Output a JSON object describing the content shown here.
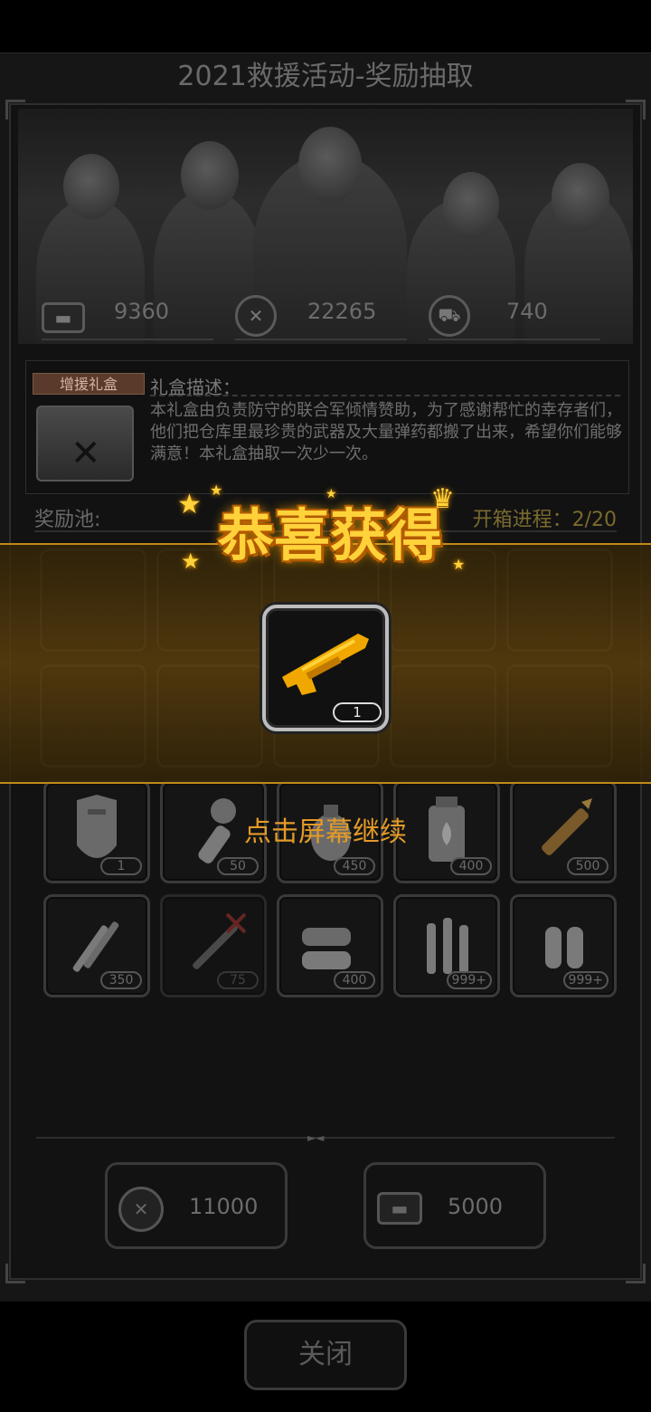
{
  "title": "2021救援活动-奖励抽取",
  "currencies": [
    {
      "icon": "card-icon",
      "value": "9360"
    },
    {
      "icon": "crossed-swords-coin-icon",
      "value": "22265"
    },
    {
      "icon": "car-coin-icon",
      "value": "740"
    }
  ],
  "gift": {
    "tag": "增援礼盒",
    "desc_title": "礼盒描述：",
    "desc_body": "本礼盒由负责防守的联合军倾情赞助，为了感谢帮忙的幸存者们，他们把仓库里最珍贵的武器及大量弹药都搬了出来，希望你们能够满意！本礼盒抽取一次少一次。"
  },
  "pool": {
    "label": "奖励池:",
    "progress": "开箱进程：2/20"
  },
  "items_row3": [
    {
      "icon": "riot-shield-icon",
      "qty": "1"
    },
    {
      "icon": "stick-grenade-icon",
      "qty": "50"
    },
    {
      "icon": "grenade-icon",
      "qty": "450"
    },
    {
      "icon": "incendiary-grenade-icon",
      "qty": "400"
    },
    {
      "icon": "rocket-ammo-icon",
      "qty": "500"
    }
  ],
  "items_row4": [
    {
      "icon": "rifle-bullets-icon",
      "qty": "350"
    },
    {
      "icon": "rpg-icon",
      "qty": "75"
    },
    {
      "icon": "shotgun-shells-icon",
      "qty": "400"
    },
    {
      "icon": "rifle-rounds-icon",
      "qty": "999+"
    },
    {
      "icon": "pistol-rounds-icon",
      "qty": "999+"
    }
  ],
  "draw_buttons": [
    {
      "icon": "crossed-swords-coin-icon",
      "value": "11000"
    },
    {
      "icon": "card-icon",
      "value": "5000"
    }
  ],
  "close_label": "关闭",
  "overlay": {
    "congrats": "恭喜获得",
    "reward_icon": "golden-shotgun-icon",
    "reward_qty": "1",
    "tap_hint": "点击屏幕继续"
  },
  "colors": {
    "accent_gold": "#ffd23a",
    "hint_orange": "#e39a28",
    "band_border": "#c08a1a"
  }
}
